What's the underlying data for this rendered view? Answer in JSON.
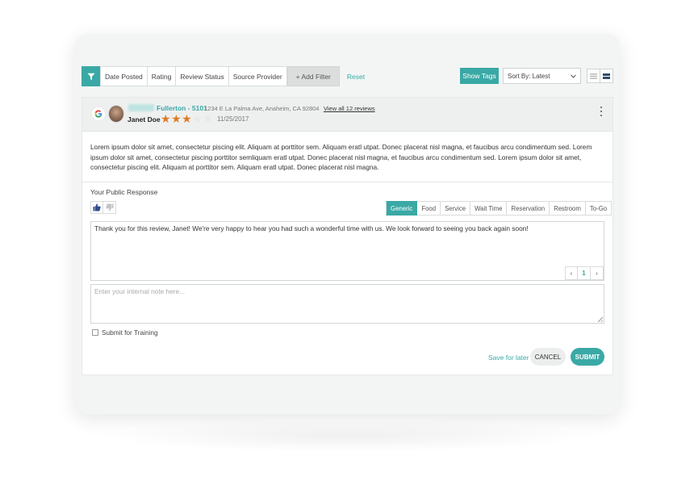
{
  "toolbar": {
    "filters": [
      "Date Posted",
      "Rating",
      "Review Status",
      "Source Provider"
    ],
    "add_filter": "+ Add Filter",
    "reset": "Reset",
    "show_tags": "Show Tags",
    "sort_value": "Sort By: Latest"
  },
  "review": {
    "location_name": "Fullerton - 5101",
    "address": "1234 E La Palma Ave, Anaheim, CA 92804",
    "view_all": "View all 12 reviews",
    "reviewer": "Janet Doe",
    "rating": 3,
    "max_rating": 5,
    "date": "11/25/2017",
    "body": "Lorem ipsum dolor sit amet, consectetur piscing elit. Aliquam at porttitor sem.  Aliquam eratl utpat. Donec placerat nisl magna, et faucibus arcu condimentum sed. Lorem ipsum dolor sit amet, consectetur piscing porttitor semliquam eratl utpat. Donec placerat nisl magna, et faucibus arcu condimentum sed. Lorem ipsum dolor sit amet, consectetur piscing elit. Aliquam at porttitor sem.  Aliquam eratl utpat. Donec placerat nisl magna."
  },
  "response": {
    "label": "Your Public Response",
    "tabs": [
      "Generic",
      "Food",
      "Service",
      "Wait Time",
      "Reservation",
      "Restroom",
      "To-Go"
    ],
    "active_tab": "Generic",
    "text": "Thank you for this review, Janet! We're very happy to hear you had such a wonderful time with us. We look forward to seeing you back again soon!",
    "page": "1",
    "prev": "‹",
    "next": "›",
    "note_placeholder": "Enter your internal note here...",
    "training_label": "Submit for Training",
    "save_later": "Save for later",
    "cancel": "CANCEL",
    "submit": "SUBMIT"
  },
  "colors": {
    "accent": "#3aa9a5",
    "star": "#e07a24"
  }
}
